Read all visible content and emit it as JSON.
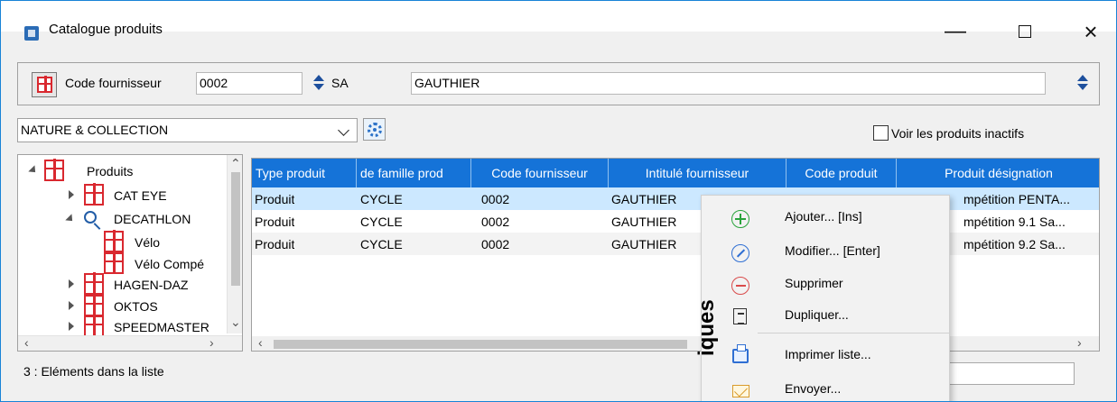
{
  "window": {
    "title": "Catalogue produits",
    "controls": {
      "minimize": "—",
      "close": "×"
    }
  },
  "supplier": {
    "label": "Code fournisseur",
    "code": "0002",
    "short_name": "SA",
    "name": "GAUTHIER"
  },
  "filters": {
    "nature": "NATURE & COLLECTION",
    "inactive_label": "Voir les produits inactifs"
  },
  "tree": {
    "items": [
      {
        "label": "Produits"
      },
      {
        "label": "CAT EYE"
      },
      {
        "label": "DECATHLON"
      },
      {
        "label": "Vélo"
      },
      {
        "label": "Vélo Compé"
      },
      {
        "label": "HAGEN-DAZ"
      },
      {
        "label": "OKTOS"
      },
      {
        "label": "SPEEDMASTER"
      }
    ]
  },
  "table": {
    "columns": [
      "Type produit",
      "de famille prod",
      "Code fournisseur",
      "Intitulé fournisseur",
      "Code produit",
      "Produit désignation"
    ],
    "rows": [
      [
        "Produit",
        "CYCLE",
        "0002",
        "GAUTHIER",
        "",
        "mpétition PENTA..."
      ],
      [
        "Produit",
        "CYCLE",
        "0002",
        "GAUTHIER",
        "",
        "mpétition 9.1 Sa..."
      ],
      [
        "Produit",
        "CYCLE",
        "0002",
        "GAUTHIER",
        "",
        "mpétition 9.2 Sa..."
      ]
    ]
  },
  "status": {
    "count_text": "3 : Eléments dans la liste"
  },
  "context_menu": {
    "items": [
      {
        "label": "Ajouter... [Ins]",
        "icon": "add-icon"
      },
      {
        "label": "Modifier... [Enter]",
        "icon": "edit-icon"
      },
      {
        "label": "Supprimer",
        "icon": "delete-icon"
      },
      {
        "label": "Dupliquer...",
        "icon": "duplicate-icon"
      },
      {
        "label": "Imprimer liste...",
        "icon": "printer-icon"
      },
      {
        "label": "Envoyer...",
        "icon": "mail-icon"
      }
    ],
    "side_text": "iques"
  },
  "colors": {
    "accent": "#1573d8",
    "selection": "#cce8ff",
    "window_border": "#1883d7",
    "product_icon": "#d9282f"
  }
}
